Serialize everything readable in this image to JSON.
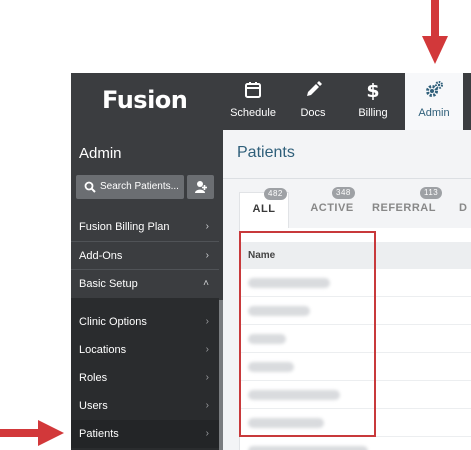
{
  "brand": {
    "name": "Fusion"
  },
  "topnav": [
    {
      "label": "Schedule",
      "icon": "calendar-icon"
    },
    {
      "label": "Docs",
      "icon": "pencil-icon"
    },
    {
      "label": "Billing",
      "icon": "dollar-icon"
    },
    {
      "label": "Admin",
      "icon": "gears-icon",
      "active": true
    }
  ],
  "sidebar": {
    "title": "Admin",
    "search_placeholder": "Search Patients...",
    "menu": [
      {
        "label": "Fusion Billing Plan",
        "chevron": "›"
      },
      {
        "label": "Add-Ons",
        "chevron": "›"
      },
      {
        "label": "Basic Setup",
        "chevron": "˄"
      }
    ],
    "submenu": [
      {
        "label": "Clinic Options",
        "chevron": "›"
      },
      {
        "label": "Locations",
        "chevron": "›"
      },
      {
        "label": "Roles",
        "chevron": "›"
      },
      {
        "label": "Users",
        "chevron": "›"
      },
      {
        "label": "Patients",
        "chevron": "›",
        "active": true
      }
    ]
  },
  "main": {
    "title": "Patients",
    "tabs": [
      {
        "label": "ALL",
        "count": "482",
        "active": true
      },
      {
        "label": "ACTIVE",
        "count": "348"
      },
      {
        "label": "REFERRAL",
        "count": "113"
      },
      {
        "label": "D",
        "count": ""
      }
    ],
    "table": {
      "header": "Name"
    }
  },
  "colors": {
    "accent": "#2f5f7a",
    "arrow": "#d2383a",
    "topbar": "#3b3d40"
  }
}
